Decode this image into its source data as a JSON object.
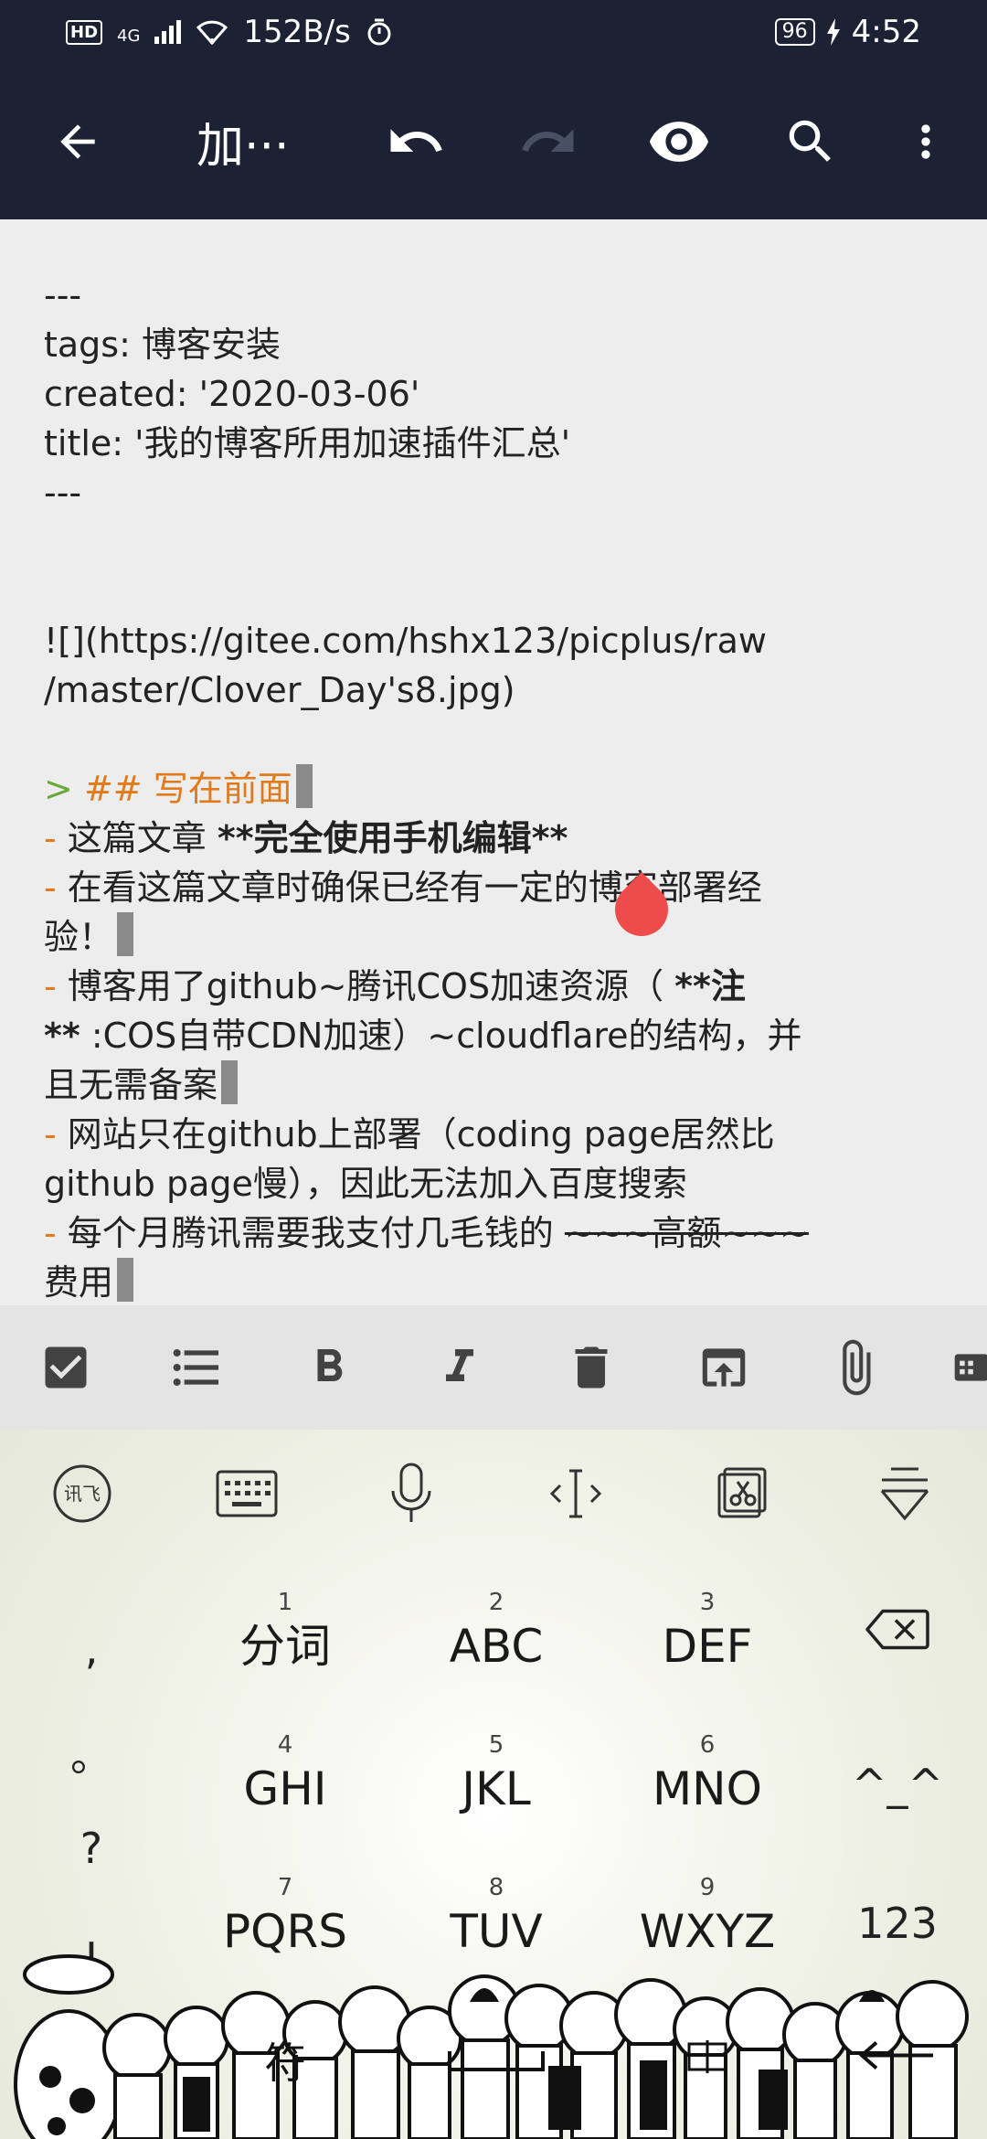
{
  "status_bar": {
    "hd": "HD",
    "network": "4G",
    "speed": "152B/s",
    "battery": "96",
    "time": "4:52"
  },
  "toolbar": {
    "title": "加···"
  },
  "editor": {
    "lines": [
      "---",
      "tags: 博客安装",
      "created: '2020-03-06'",
      "title: '我的博客所用加速插件汇总'",
      "---",
      "",
      "",
      "![](https://gitee.com/hshx123/picplus/raw",
      "/master/Clover_Day's8.jpg)",
      ""
    ],
    "heading_quote": ">",
    "heading": "## 写在前面",
    "list_marker": "-",
    "item1_text": " 这篇文章 ",
    "item1_bold": "**完全使用手机编辑**",
    "item2_a": " 在看这篇文章时确保已经有一定的博客部署经",
    "item2_b": "验！",
    "item3_text": " 博客用了github~腾讯COS加速资源（ ",
    "item3_bold": "**注",
    "item3_b_bold": "**",
    "item3_b": " :COS自带CDN加速）~cloudflare的结构，并",
    "item3_c": "且无需备案",
    "item4_a": " 网站只在github上部署（coding page居然比",
    "item4_b": "github page慢），因此无法加入百度搜索",
    "item5_text": " 每个月腾讯需要我支付几毛钱的 ",
    "item5_strike": "~~~高额~~~",
    "item5_b": "费用"
  },
  "keyboard": {
    "keys": [
      {
        "num": "1",
        "label": "分词"
      },
      {
        "num": "2",
        "label": "ABC"
      },
      {
        "num": "3",
        "label": "DEF"
      },
      {
        "num": "4",
        "label": "GHI"
      },
      {
        "num": "5",
        "label": "JKL"
      },
      {
        "num": "6",
        "label": "MNO"
      },
      {
        "num": "7",
        "label": "PQRS"
      },
      {
        "num": "8",
        "label": "TUV"
      },
      {
        "num": "9",
        "label": "WXYZ"
      }
    ],
    "punct": [
      ",",
      "。",
      "?",
      "!"
    ],
    "emoji_key": "^_^",
    "num_key": "123",
    "symbol_key": "符"
  }
}
